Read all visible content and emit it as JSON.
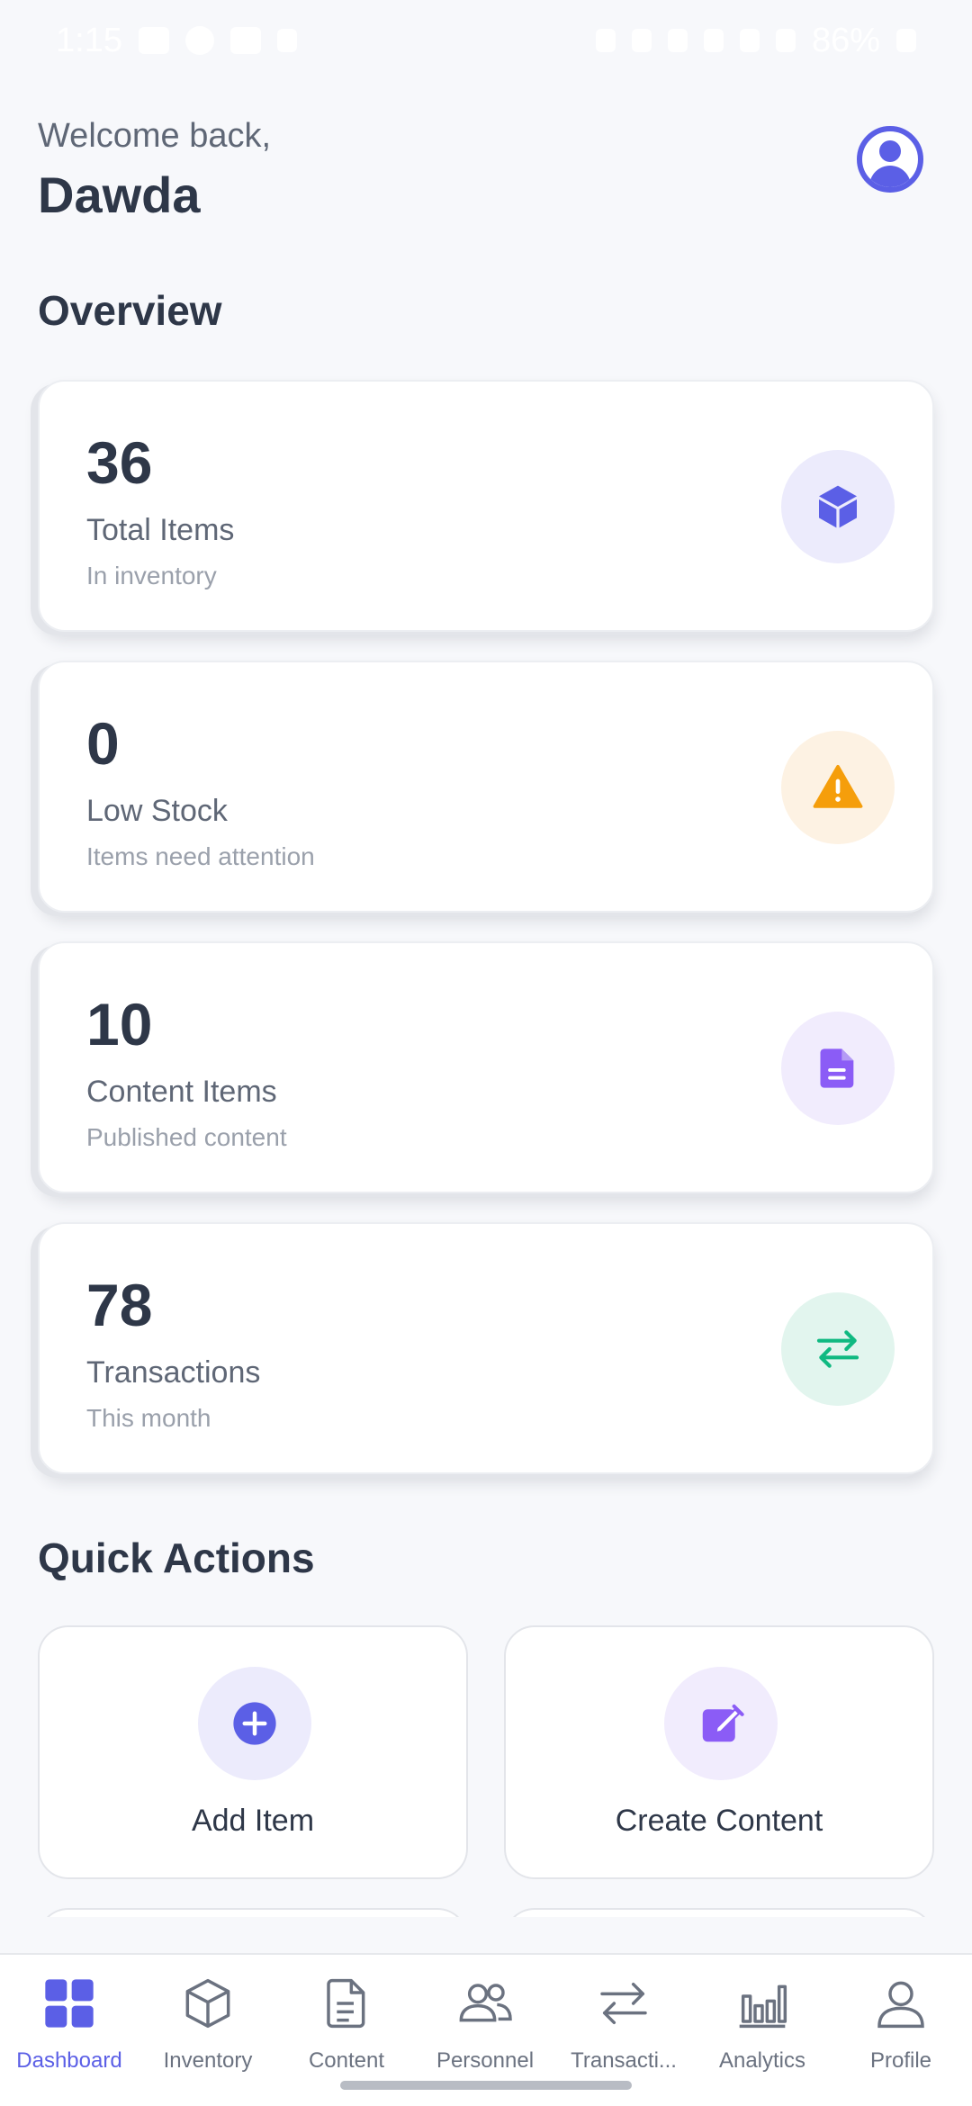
{
  "status_bar": {
    "time": "1:15",
    "battery": "86%"
  },
  "header": {
    "greeting": "Welcome back,",
    "user_name": "Dawda"
  },
  "overview": {
    "title": "Overview",
    "cards": [
      {
        "value": "36",
        "label": "Total Items",
        "sub": "In inventory",
        "icon": "cube-icon",
        "icon_color": "#5b5fe6",
        "bg_color": "#ecebfc"
      },
      {
        "value": "0",
        "label": "Low Stock",
        "sub": "Items need attention",
        "icon": "warning-icon",
        "icon_color": "#f59e0b",
        "bg_color": "#fdf2e3"
      },
      {
        "value": "10",
        "label": "Content Items",
        "sub": "Published content",
        "icon": "document-icon",
        "icon_color": "#8b5cf6",
        "bg_color": "#f1ecfd"
      },
      {
        "value": "78",
        "label": "Transactions",
        "sub": "This month",
        "icon": "swap-arrows-icon",
        "icon_color": "#10b981",
        "bg_color": "#e2f5ee"
      }
    ]
  },
  "quick_actions": {
    "title": "Quick Actions",
    "items": [
      {
        "label": "Add Item",
        "icon": "plus-circle-icon",
        "icon_color": "#5b5fe6",
        "bg_color": "#ecebfc"
      },
      {
        "label": "Create Content",
        "icon": "edit-icon",
        "icon_color": "#8b5cf6",
        "bg_color": "#f1ecfd"
      }
    ]
  },
  "nav": {
    "active_color": "#5b5fe6",
    "items": [
      {
        "label": "Dashboard",
        "icon": "grid-icon",
        "active": true
      },
      {
        "label": "Inventory",
        "icon": "cube-outline-icon",
        "active": false
      },
      {
        "label": "Content",
        "icon": "document-outline-icon",
        "active": false
      },
      {
        "label": "Personnel",
        "icon": "people-icon",
        "active": false
      },
      {
        "label": "Transacti...",
        "icon": "swap-icon",
        "active": false
      },
      {
        "label": "Analytics",
        "icon": "bar-chart-icon",
        "active": false
      },
      {
        "label": "Profile",
        "icon": "person-icon",
        "active": false
      }
    ]
  }
}
